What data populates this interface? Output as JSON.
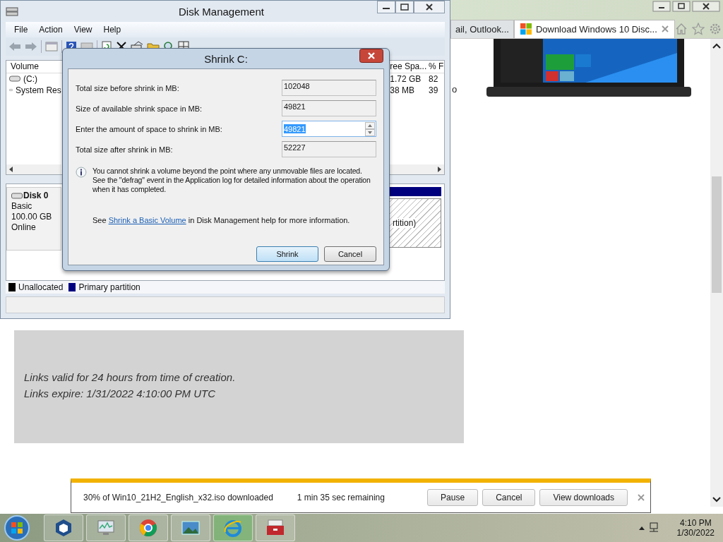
{
  "browser": {
    "tabs": [
      {
        "label": "ail, Outlook...",
        "selected": false
      },
      {
        "label": "Download Windows 10 Disc...",
        "selected": true
      }
    ],
    "partial_text": "o",
    "notice": [
      "Links valid for 24 hours from time of creation.",
      "Links expire: 1/31/2022 4:10:00 PM UTC"
    ],
    "download_bar": {
      "status": "30% of Win10_21H2_English_x32.iso downloaded",
      "remaining": "1 min 35 sec remaining",
      "buttons": [
        "Pause",
        "Cancel",
        "View downloads"
      ]
    }
  },
  "disk_management": {
    "title": "Disk Management",
    "menu": [
      "File",
      "Action",
      "View",
      "Help"
    ],
    "volume_columns": [
      "Volume",
      "ree Spa...",
      "% F"
    ],
    "volumes": [
      {
        "name": "(C:)",
        "free": "1.72 GB",
        "percent": "82"
      },
      {
        "name": "System Res",
        "free": "38 MB",
        "percent": "39"
      }
    ],
    "disk": {
      "name": "Disk 0",
      "lines": [
        "Basic",
        "100.00 GB",
        "Online"
      ],
      "partition_label": "rtition)"
    },
    "legend": [
      {
        "label": "Unallocated",
        "color": "#000000"
      },
      {
        "label": "Primary partition",
        "color": "#00007f"
      }
    ]
  },
  "dialog": {
    "title": "Shrink C:",
    "fields": [
      {
        "label": "Total size before shrink in MB:",
        "value": "102048",
        "kind": "readonly",
        "highlighted": false
      },
      {
        "label": "Size of available shrink space in MB:",
        "value": "49821",
        "kind": "readonly",
        "highlighted": false
      },
      {
        "label": "Enter the amount of space to shrink in MB:",
        "value": "49821",
        "kind": "spin",
        "highlighted": true
      },
      {
        "label": "Total size after shrink in MB:",
        "value": "52227",
        "kind": "readonly",
        "highlighted": false
      }
    ],
    "info": "You cannot shrink a volume beyond the point where any unmovable files are located. See the \"defrag\" event in the Application log for detailed information about the operation when it has completed.",
    "help": {
      "before": "See",
      "link": "Shrink a Basic Volume",
      "after": "in Disk Management help for more information."
    },
    "buttons": [
      {
        "label": "Shrink",
        "default": true
      },
      {
        "label": "Cancel",
        "default": false
      }
    ]
  },
  "taskbar": {
    "time": "4:10 PM",
    "date": "1/30/2022"
  }
}
